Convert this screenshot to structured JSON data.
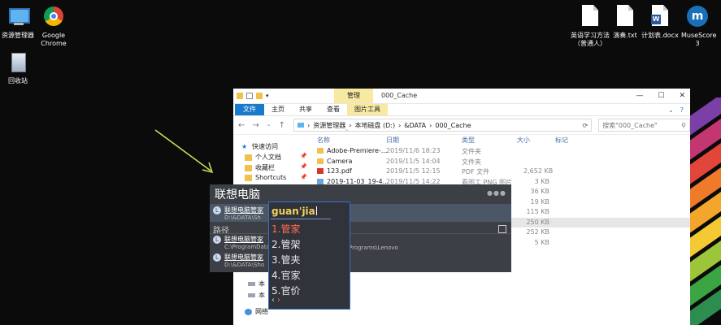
{
  "desktop": {
    "left_icons": [
      {
        "label": "资源管理器",
        "icon": "pc-icon"
      },
      {
        "label": "Google Chrome",
        "icon": "chrome-icon"
      },
      {
        "label": "回收站",
        "icon": "recycle-bin-icon"
      }
    ],
    "right_icons": [
      {
        "label": "英语学习方法（普通人）",
        "icon": "text-doc-icon"
      },
      {
        "label": "演奏.txt",
        "icon": "text-doc-icon"
      },
      {
        "label": "计划表.docx",
        "icon": "word-doc-icon"
      },
      {
        "label": "MuseScore 3",
        "icon": "musescore-icon"
      }
    ]
  },
  "explorer": {
    "context_tab": "管理",
    "window_title": "000_Cache",
    "ribbon_tabs": [
      "文件",
      "主页",
      "共享",
      "查看",
      "图片工具"
    ],
    "address": [
      "资源管理器",
      "本地磁盘 (D:)",
      "&DATA",
      "000_Cache"
    ],
    "search_placeholder": "搜索\"000_Cache\"",
    "nav_items": [
      {
        "label": "快速访问"
      },
      {
        "label": "个人文档"
      },
      {
        "label": "收藏栏"
      },
      {
        "label": "Shortcuts"
      },
      {
        "label": "本"
      },
      {
        "label": "本"
      },
      {
        "label": "网络"
      }
    ],
    "columns": [
      "名称",
      "日期",
      "类型",
      "大小",
      "标记"
    ],
    "rows": [
      {
        "name": "Adobe-Premiere-...",
        "date": "2019/11/6 18:23",
        "type": "文件夹",
        "size": ""
      },
      {
        "name": "Camera",
        "date": "2019/11/5 14:04",
        "type": "文件夹",
        "size": ""
      },
      {
        "name": "123.pdf",
        "date": "2019/11/5 12:15",
        "type": "PDF 文件",
        "size": "2,652 KB"
      },
      {
        "name": "2019-11-03_19-4...",
        "date": "2019/11/5 14:22",
        "type": "看图工 PNG 图片",
        "size": "3 KB"
      },
      {
        "name": "",
        "date": "",
        "type": "",
        "size": "36 KB"
      },
      {
        "name": "",
        "date": "",
        "type": "",
        "size": "19 KB"
      },
      {
        "name": "",
        "date": "",
        "type": "",
        "size": "115 KB"
      },
      {
        "name": "",
        "date": "",
        "type": "",
        "size": "250 KB"
      },
      {
        "name": "",
        "date": "",
        "type": "",
        "size": "252 KB"
      },
      {
        "name": "",
        "date": "",
        "type": "",
        "size": "5 KB"
      }
    ]
  },
  "lenovo_search": {
    "title": "联想电脑",
    "top_item": {
      "name": "联想电脑管家",
      "path": "D:\\&DATA\\Sh"
    },
    "section_label": "路径",
    "paths": [
      {
        "name": "联想电脑管家",
        "path": "C:\\ProgramData"
      },
      {
        "name": "联想电脑管家",
        "path": "D:\\&DATA\\Sho"
      }
    ],
    "path_tail": "Programs\\Lenovo"
  },
  "ime": {
    "composition": "guan'jia",
    "candidates": [
      "1.管家",
      "2.管架",
      "3.管夹",
      "4.官家",
      "5.官价"
    ]
  }
}
